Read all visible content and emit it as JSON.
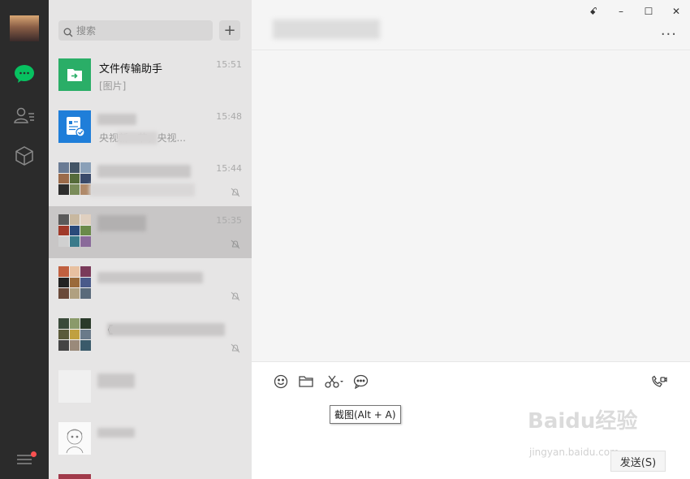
{
  "search": {
    "placeholder": "搜索"
  },
  "add_button_label": "+",
  "chats": [
    {
      "name": "文件传输助手",
      "preview": "[图片]",
      "time": "15:51"
    },
    {
      "name": "",
      "preview": "央视新...节，央视...",
      "time": "15:48"
    },
    {
      "name": "",
      "preview": "",
      "time": "15:44",
      "muted": true
    },
    {
      "name": "",
      "preview": "",
      "time": "15:35",
      "muted": true,
      "active": true
    },
    {
      "name": "",
      "preview": "",
      "time": "",
      "muted": true
    },
    {
      "name": "《",
      "preview": "",
      "time": "",
      "muted": true
    },
    {
      "name": "",
      "preview": "",
      "time": ""
    },
    {
      "name": "",
      "preview": "",
      "time": ""
    }
  ],
  "window": {
    "pin": "ꗃ",
    "minimize": "–",
    "maximize": "☐",
    "close": "✕"
  },
  "header": {
    "more": "···"
  },
  "toolbar": {
    "tooltip": "截图(Alt + A)",
    "send_label": "发送(S)"
  },
  "watermark": {
    "brand": "Baidu经验",
    "url": "jingyan.baidu.com"
  },
  "colors": {
    "accent_green": "#07c160",
    "rail": "#2b2b2b",
    "list_bg": "#e6e5e5"
  },
  "icons": [
    "chat-icon",
    "contacts-icon",
    "cube-icon",
    "menu-icon",
    "search-icon",
    "emoji-icon",
    "folder-icon",
    "scissors-icon",
    "bubble-icon",
    "video-call-icon",
    "mute-icon"
  ]
}
